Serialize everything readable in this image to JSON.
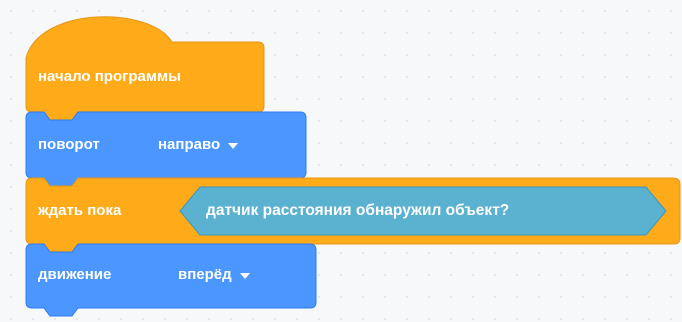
{
  "colors": {
    "event_orange": "#ffab19",
    "event_orange_dark": "#e6961a",
    "motion_blue": "#4c97ff",
    "motion_blue_dark": "#2f7bf0",
    "control_orange": "#ffab19",
    "sensor_teal": "#5ab2d0",
    "sensor_teal_dark": "#3f97b8"
  },
  "blocks": {
    "start": {
      "label": "начало программы"
    },
    "turn": {
      "label": "поворот",
      "dropdown_value": "направо"
    },
    "wait_until": {
      "label": "ждать пока",
      "sensor": {
        "label": "датчик расстояния обнаружил объект?"
      }
    },
    "move": {
      "label": "движение",
      "dropdown_value": "вперёд"
    }
  }
}
